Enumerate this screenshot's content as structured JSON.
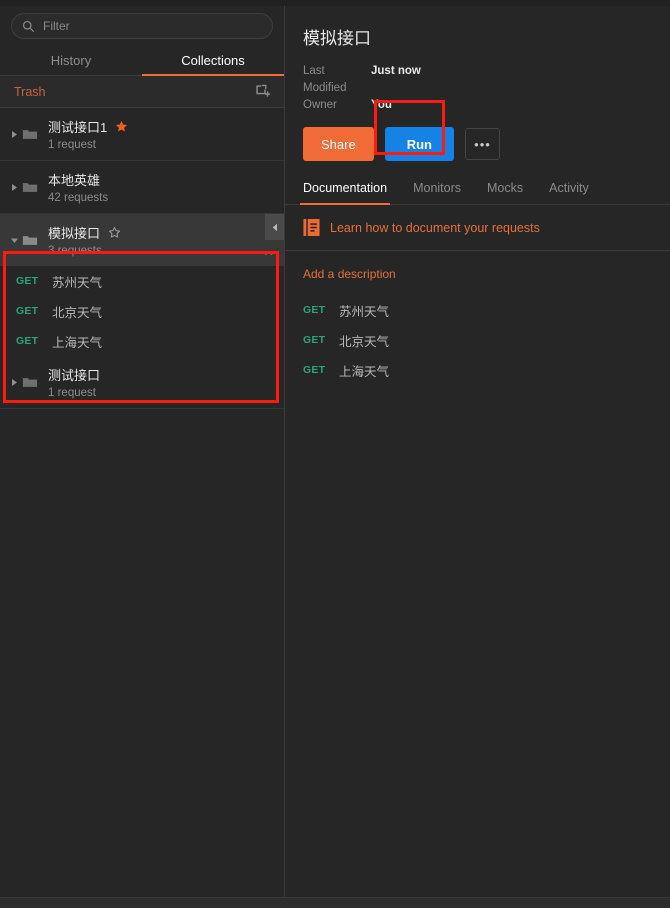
{
  "sidebar": {
    "search": {
      "placeholder": "Filter",
      "value": ""
    },
    "tabs": [
      {
        "label": "History",
        "active": false
      },
      {
        "label": "Collections",
        "active": true
      }
    ],
    "trash": {
      "label": "Trash",
      "new_collection_icon": "new-collection-icon"
    },
    "collections": [
      {
        "name": "测试接口1",
        "count": "1 request",
        "starred": true,
        "expanded": false,
        "selected": false,
        "requests": []
      },
      {
        "name": "本地英雄",
        "count": "42 requests",
        "starred": false,
        "expanded": false,
        "selected": false,
        "requests": []
      },
      {
        "name": "模拟接口",
        "count": "3 requests",
        "starred": false,
        "expanded": true,
        "selected": true,
        "requests": [
          {
            "method": "GET",
            "name": "苏州天气"
          },
          {
            "method": "GET",
            "name": "北京天气"
          },
          {
            "method": "GET",
            "name": "上海天气"
          }
        ]
      },
      {
        "name": "测试接口",
        "count": "1 request",
        "starred": false,
        "expanded": false,
        "selected": false,
        "requests": []
      }
    ]
  },
  "main": {
    "title": "模拟接口",
    "meta": [
      {
        "key": "Last Modified",
        "value": "Just now"
      },
      {
        "key": "Owner",
        "value": "You"
      }
    ],
    "actions": {
      "share_label": "Share",
      "run_label": "Run",
      "more_label": "•••"
    },
    "tabs": [
      {
        "label": "Documentation",
        "active": true
      },
      {
        "label": "Monitors",
        "active": false
      },
      {
        "label": "Mocks",
        "active": false
      },
      {
        "label": "Activity",
        "active": false
      }
    ],
    "learn_banner": {
      "text": "Learn how to document your requests",
      "icon": "documentation-book-icon"
    },
    "description_link": "Add a description",
    "requests": [
      {
        "method": "GET",
        "name": "苏州天气"
      },
      {
        "method": "GET",
        "name": "北京天气"
      },
      {
        "method": "GET",
        "name": "上海天气"
      }
    ]
  },
  "annotations": {
    "collection_highlight_color": "#ff1a10",
    "run_highlight_color": "#ff1a10"
  },
  "colors": {
    "accent_orange": "#f26b3a",
    "run_blue": "#1682e6",
    "share_orange": "#f06b35",
    "method_get_green": "#29a47c",
    "background": "#262626"
  }
}
